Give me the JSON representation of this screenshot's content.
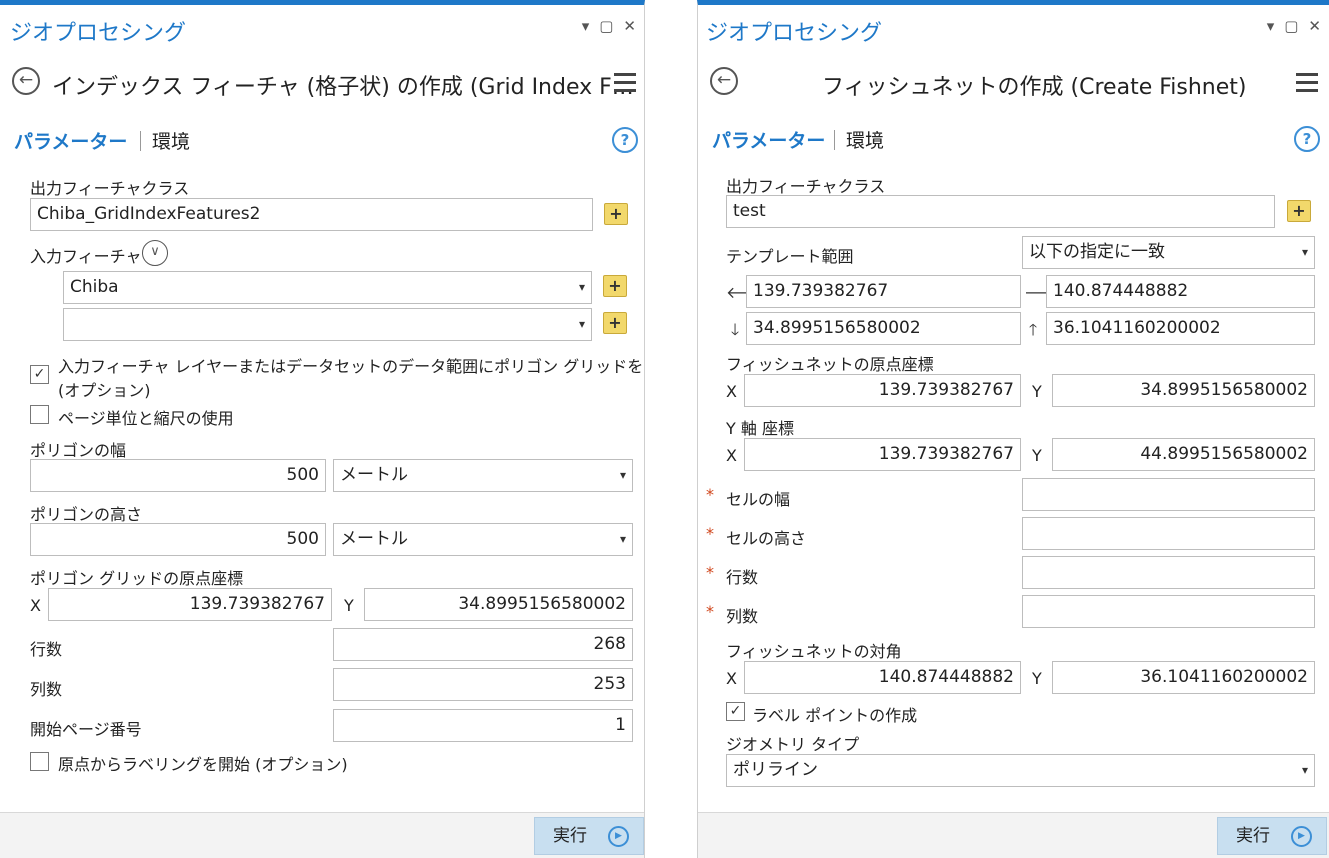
{
  "left": {
    "pane_title": "ジオプロセシング",
    "window_buttons": [
      "▾",
      "▢",
      "✕"
    ],
    "tool_title": "インデックス フィーチャ (格子状) の作成 (Grid Index F…",
    "tabs": {
      "parameters": "パラメーター",
      "environments": "環境"
    },
    "help": "?",
    "output_fc_label": "出力フィーチャクラス",
    "output_fc_value": "Chiba_GridIndexFeatures2",
    "input_features_label": "入力フィーチャ",
    "input_features": [
      "Chiba",
      ""
    ],
    "checkbox_extent_label_1": "入力フィーチャ レイヤーまたはデータセットのデータ範囲にポリゴン グリッドを生成",
    "checkbox_extent_label_2": "(オプション)",
    "checkbox_extent_checked": true,
    "checkbox_page_label": "ページ単位と縮尺の使用",
    "checkbox_page_checked": false,
    "polygon_width_label": "ポリゴンの幅",
    "polygon_width_value": "500",
    "polygon_width_unit": "メートル",
    "polygon_height_label": "ポリゴンの高さ",
    "polygon_height_value": "500",
    "polygon_height_unit": "メートル",
    "origin_label": "ポリゴン グリッドの原点座標",
    "origin_x_label": "X",
    "origin_x": "139.739382767",
    "origin_y_label": "Y",
    "origin_y": "34.8995156580002",
    "rows_label": "行数",
    "rows_value": "268",
    "cols_label": "列数",
    "cols_value": "253",
    "start_page_label": "開始ページ番号",
    "start_page_value": "1",
    "checkbox_labeling_label": "原点からラベリングを開始 (オプション)",
    "checkbox_labeling_checked": false,
    "run_label": "実行"
  },
  "right": {
    "pane_title": "ジオプロセシング",
    "window_buttons": [
      "▾",
      "▢",
      "✕"
    ],
    "tool_title": "フィッシュネットの作成 (Create Fishnet)",
    "tabs": {
      "parameters": "パラメーター",
      "environments": "環境"
    },
    "help": "?",
    "output_fc_label": "出力フィーチャクラス",
    "output_fc_value": "test",
    "template_extent_label": "テンプレート範囲",
    "template_extent_value": "以下の指定に一致",
    "extent_left": "139.739382767",
    "extent_right": "140.874448882",
    "extent_bottom": "34.8995156580002",
    "extent_top": "36.1041160200002",
    "origin_label": "フィッシュネットの原点座標",
    "origin_x": "139.739382767",
    "origin_y": "34.8995156580002",
    "yaxis_label": "Y 軸 座標",
    "yaxis_x": "139.739382767",
    "yaxis_y": "44.8995156580002",
    "x_label": "X",
    "y_label": "Y",
    "required_mark": "*",
    "cell_width_label": "セルの幅",
    "cell_height_label": "セルの高さ",
    "rows_label": "行数",
    "cols_label": "列数",
    "opposite_label": "フィッシュネットの対角",
    "opposite_x": "140.874448882",
    "opposite_y": "36.1041160200002",
    "label_points_label": "ラベル ポイントの作成",
    "label_points_checked": true,
    "geometry_type_label": "ジオメトリ タイプ",
    "geometry_type_value": "ポリライン",
    "run_label": "実行"
  },
  "icons": {
    "back": "back-arrow-icon",
    "menu": "hamburger-menu-icon",
    "help": "help-icon",
    "add": "add-data-icon",
    "expand": "chevron-down-circle-icon",
    "run": "play-icon",
    "arrows": [
      "arrow-left-icon",
      "arrow-right-icon",
      "arrow-down-icon",
      "arrow-up-icon"
    ]
  },
  "colors": {
    "accent": "#1e78c8",
    "required": "#d0451b",
    "run_button": "#c8dff0"
  }
}
